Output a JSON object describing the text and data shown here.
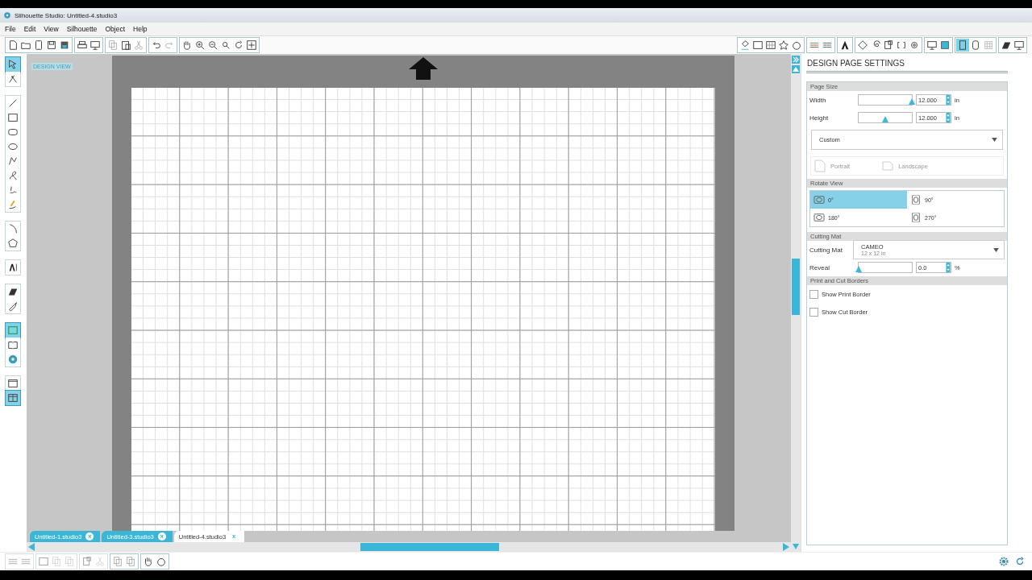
{
  "window": {
    "title": "Silhouette Studio: Untitled-4.studio3"
  },
  "menu": [
    "File",
    "Edit",
    "View",
    "Silhouette",
    "Object",
    "Help"
  ],
  "right_toolbar": [
    {
      "selected": false
    },
    {
      "selected": false
    },
    {
      "selected": false
    },
    {
      "selected": false
    },
    {
      "selected": false
    },
    {
      "selected": false
    },
    {
      "selected": false
    },
    {
      "selected": false
    },
    {
      "selected": false
    },
    {
      "selected": false
    },
    {
      "selected": false
    },
    {
      "selected": false
    },
    {
      "selected": false
    },
    {
      "selected": false
    },
    {
      "selected": false
    },
    {
      "selected": true
    },
    {
      "selected": false
    },
    {
      "selected": false
    },
    {
      "selected": false
    },
    {
      "selected": false
    }
  ],
  "left_tools": [
    {
      "selected": true
    },
    {
      "selected": false
    },
    {
      "selected": false
    },
    {
      "selected": false
    },
    {
      "selected": false
    },
    {
      "selected": false
    },
    {
      "selected": false
    },
    {
      "selected": false
    },
    {
      "selected": false
    },
    {
      "selected": false
    },
    {
      "selected": false
    },
    {
      "selected": false
    },
    {
      "selected": false
    },
    {
      "selected": false
    },
    {
      "selected": false
    },
    {
      "selected": true
    },
    {
      "selected": false
    },
    {
      "selected": false
    },
    {
      "selected": false
    },
    {
      "selected": true
    }
  ],
  "canvas": {
    "view_label": "DESIGN VIEW"
  },
  "document_tabs": [
    {
      "label": "Untitled-1.studio3",
      "close": "x",
      "selected": false
    },
    {
      "label": "Untitled-3.studio3",
      "close": "x",
      "selected": false
    },
    {
      "label": "Untitled-4.studio3",
      "close": "x",
      "selected": true
    }
  ],
  "panel": {
    "title": "DESIGN PAGE SETTINGS",
    "page_size": {
      "heading": "Page Size",
      "fields": [
        {
          "label": "Width",
          "value": "12.000",
          "unit": "in",
          "level": 1.0
        },
        {
          "label": "Height",
          "value": "12.000",
          "unit": "in",
          "level": 0.5
        }
      ],
      "preset": "Custom",
      "orientations": [
        {
          "label": "Portrait",
          "disabled": true
        },
        {
          "label": "Landscape",
          "disabled": true
        }
      ]
    },
    "rotate_view": {
      "heading": "Rotate View",
      "options": [
        {
          "label": "0°",
          "selected": true
        },
        {
          "label": "90°",
          "selected": false
        },
        {
          "label": "180°",
          "selected": false
        },
        {
          "label": "270°",
          "selected": false
        }
      ]
    },
    "cutting_mat": {
      "heading": "Cutting Mat",
      "label": "Cutting Mat",
      "value": "CAMEO",
      "detail": "12 x 12 in",
      "reveal_label": "Reveal",
      "reveal_value": "0.0",
      "reveal_unit": "%",
      "level": 0
    },
    "borders": {
      "heading": "Print and Cut Borders",
      "options": [
        {
          "label": "Show Print Border",
          "checked": false
        },
        {
          "label": "Show Cut Border",
          "checked": false
        }
      ]
    }
  }
}
